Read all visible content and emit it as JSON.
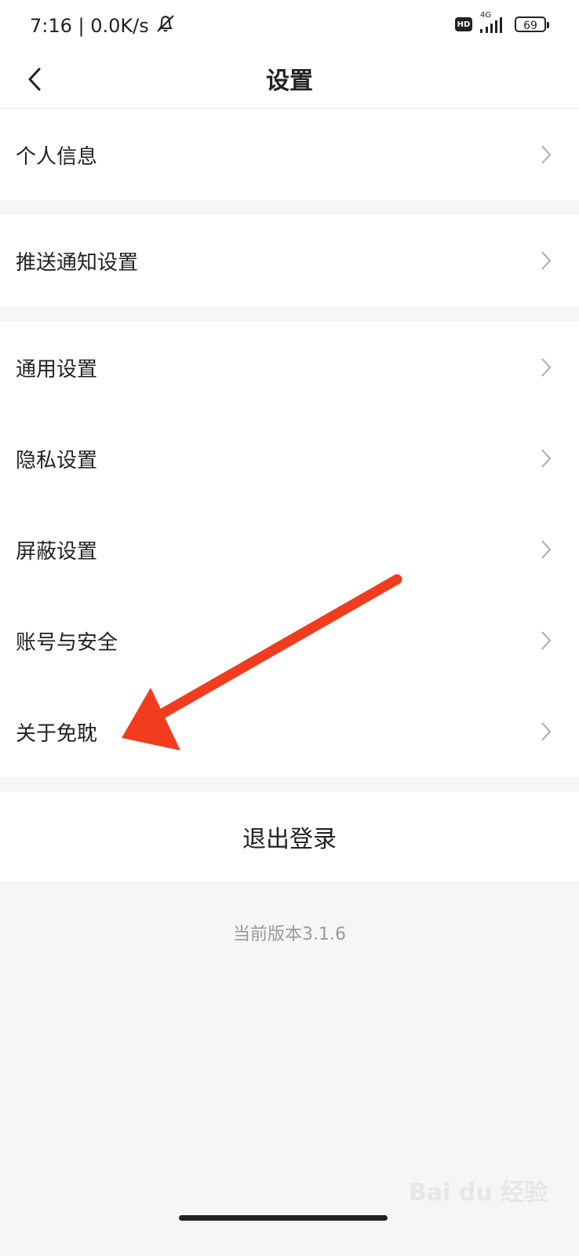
{
  "status_bar": {
    "time_speed": "7:16 | 0.0K/s",
    "network": "4G",
    "battery": "69",
    "icons": [
      "mute-bell-icon",
      "hd-icon",
      "signal-icon",
      "battery-icon"
    ]
  },
  "header": {
    "title": "设置",
    "back_icon": "chevron-left-icon"
  },
  "groups": [
    {
      "items": [
        "个人信息"
      ]
    },
    {
      "items": [
        "推送通知设置"
      ]
    },
    {
      "items": [
        "通用设置",
        "隐私设置",
        "屏蔽设置",
        "账号与安全",
        "关于免耽"
      ]
    }
  ],
  "logout_label": "退出登录",
  "version_text": "当前版本3.1.6",
  "watermark": "Bai du 经验",
  "colors": {
    "arrow": "#f23c1e",
    "text": "#222222",
    "subtle": "#999999",
    "background": "#f6f6f6"
  }
}
